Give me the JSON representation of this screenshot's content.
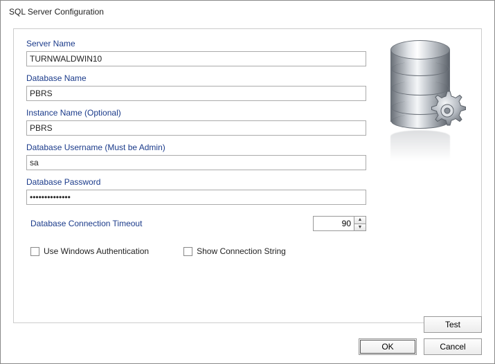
{
  "window": {
    "title": "SQL Server Configuration"
  },
  "labels": {
    "server_name": "Server Name",
    "database_name": "Database Name",
    "instance_name": "Instance Name (Optional)",
    "db_username": "Database Username (Must be Admin)",
    "db_password": "Database Password",
    "conn_timeout": "Database Connection Timeout"
  },
  "fields": {
    "server_name": "TURNWALDWIN10",
    "database_name": "PBRS",
    "instance_name": "PBRS",
    "db_username": "sa",
    "db_password": "••••••••••••••",
    "conn_timeout": "90"
  },
  "checkboxes": {
    "win_auth": "Use Windows Authentication",
    "show_conn": "Show Connection String"
  },
  "buttons": {
    "test": "Test",
    "ok": "OK",
    "cancel": "Cancel"
  }
}
